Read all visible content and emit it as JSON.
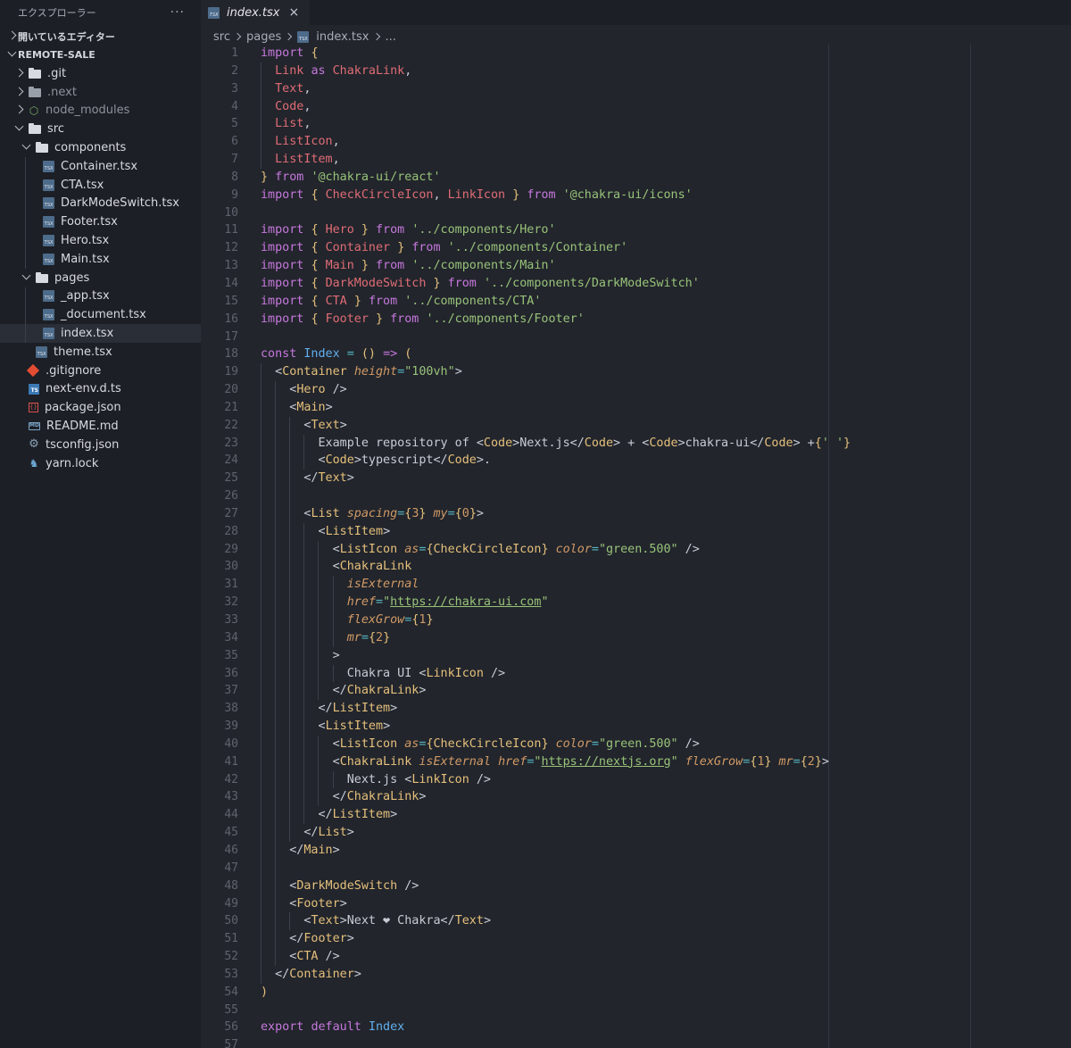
{
  "explorer": {
    "title": "エクスプローラー",
    "more": "···",
    "open_editors": "開いているエディター",
    "project": "REMOTE-SALE",
    "tree": [
      {
        "label": ".git",
        "type": "folder",
        "depth": 1,
        "state": "closed",
        "dim": false
      },
      {
        "label": ".next",
        "type": "folder",
        "depth": 1,
        "state": "closed",
        "dim": true
      },
      {
        "label": "node_modules",
        "type": "node",
        "depth": 1,
        "state": "closed",
        "dim": true
      },
      {
        "label": "src",
        "type": "folder",
        "depth": 1,
        "state": "open",
        "dim": false
      },
      {
        "label": "components",
        "type": "folder",
        "depth": 2,
        "state": "open",
        "dim": false
      },
      {
        "label": "Container.tsx",
        "type": "tsx",
        "depth": 3
      },
      {
        "label": "CTA.tsx",
        "type": "tsx",
        "depth": 3
      },
      {
        "label": "DarkModeSwitch.tsx",
        "type": "tsx",
        "depth": 3
      },
      {
        "label": "Footer.tsx",
        "type": "tsx",
        "depth": 3
      },
      {
        "label": "Hero.tsx",
        "type": "tsx",
        "depth": 3
      },
      {
        "label": "Main.tsx",
        "type": "tsx",
        "depth": 3
      },
      {
        "label": "pages",
        "type": "folder",
        "depth": 2,
        "state": "open",
        "dim": false
      },
      {
        "label": "_app.tsx",
        "type": "tsx",
        "depth": 3
      },
      {
        "label": "_document.tsx",
        "type": "tsx",
        "depth": 3
      },
      {
        "label": "index.tsx",
        "type": "tsx",
        "depth": 3,
        "selected": true
      },
      {
        "label": "theme.tsx",
        "type": "tsx",
        "depth": 2
      },
      {
        "label": ".gitignore",
        "type": "git",
        "depth": 1
      },
      {
        "label": "next-env.d.ts",
        "type": "ts",
        "depth": 1
      },
      {
        "label": "package.json",
        "type": "json",
        "depth": 1
      },
      {
        "label": "README.md",
        "type": "md",
        "depth": 1
      },
      {
        "label": "tsconfig.json",
        "type": "gear",
        "depth": 1
      },
      {
        "label": "yarn.lock",
        "type": "yarn",
        "depth": 1
      }
    ]
  },
  "tab": {
    "label": "index.tsx",
    "close": "×"
  },
  "breadcrumb": {
    "src": "src",
    "pages": "pages",
    "file": "index.tsx",
    "more": "..."
  },
  "icons": {
    "tsx": "TSX",
    "ts": "TS",
    "json": "{}",
    "md": "MD",
    "gear": "⚙",
    "yarn": "♞",
    "node": "⬡"
  },
  "code_lines": [
    [
      [
        "kw",
        "import"
      ],
      [
        "pu",
        " "
      ],
      [
        "br",
        "{"
      ]
    ],
    [
      [
        "pu",
        "  "
      ],
      [
        "id",
        "Link"
      ],
      [
        "pu",
        " "
      ],
      [
        "kw",
        "as"
      ],
      [
        "pu",
        " "
      ],
      [
        "id",
        "ChakraLink"
      ],
      [
        "pu",
        ","
      ]
    ],
    [
      [
        "pu",
        "  "
      ],
      [
        "id",
        "Text"
      ],
      [
        "pu",
        ","
      ]
    ],
    [
      [
        "pu",
        "  "
      ],
      [
        "id",
        "Code"
      ],
      [
        "pu",
        ","
      ]
    ],
    [
      [
        "pu",
        "  "
      ],
      [
        "id",
        "List"
      ],
      [
        "pu",
        ","
      ]
    ],
    [
      [
        "pu",
        "  "
      ],
      [
        "id",
        "ListIcon"
      ],
      [
        "pu",
        ","
      ]
    ],
    [
      [
        "pu",
        "  "
      ],
      [
        "id",
        "ListItem"
      ],
      [
        "pu",
        ","
      ]
    ],
    [
      [
        "br",
        "}"
      ],
      [
        "pu",
        " "
      ],
      [
        "kw",
        "from"
      ],
      [
        "pu",
        " "
      ],
      [
        "str",
        "'@chakra-ui/react'"
      ]
    ],
    [
      [
        "kw",
        "import"
      ],
      [
        "pu",
        " "
      ],
      [
        "br",
        "{"
      ],
      [
        "pu",
        " "
      ],
      [
        "id",
        "CheckCircleIcon"
      ],
      [
        "pu",
        ", "
      ],
      [
        "id",
        "LinkIcon"
      ],
      [
        "pu",
        " "
      ],
      [
        "br",
        "}"
      ],
      [
        "pu",
        " "
      ],
      [
        "kw",
        "from"
      ],
      [
        "pu",
        " "
      ],
      [
        "str",
        "'@chakra-ui/icons'"
      ]
    ],
    [],
    [
      [
        "kw",
        "import"
      ],
      [
        "pu",
        " "
      ],
      [
        "br",
        "{"
      ],
      [
        "pu",
        " "
      ],
      [
        "id",
        "Hero"
      ],
      [
        "pu",
        " "
      ],
      [
        "br",
        "}"
      ],
      [
        "pu",
        " "
      ],
      [
        "kw",
        "from"
      ],
      [
        "pu",
        " "
      ],
      [
        "str",
        "'../components/Hero'"
      ]
    ],
    [
      [
        "kw",
        "import"
      ],
      [
        "pu",
        " "
      ],
      [
        "br",
        "{"
      ],
      [
        "pu",
        " "
      ],
      [
        "id",
        "Container"
      ],
      [
        "pu",
        " "
      ],
      [
        "br",
        "}"
      ],
      [
        "pu",
        " "
      ],
      [
        "kw",
        "from"
      ],
      [
        "pu",
        " "
      ],
      [
        "str",
        "'../components/Container'"
      ]
    ],
    [
      [
        "kw",
        "import"
      ],
      [
        "pu",
        " "
      ],
      [
        "br",
        "{"
      ],
      [
        "pu",
        " "
      ],
      [
        "id",
        "Main"
      ],
      [
        "pu",
        " "
      ],
      [
        "br",
        "}"
      ],
      [
        "pu",
        " "
      ],
      [
        "kw",
        "from"
      ],
      [
        "pu",
        " "
      ],
      [
        "str",
        "'../components/Main'"
      ]
    ],
    [
      [
        "kw",
        "import"
      ],
      [
        "pu",
        " "
      ],
      [
        "br",
        "{"
      ],
      [
        "pu",
        " "
      ],
      [
        "id",
        "DarkModeSwitch"
      ],
      [
        "pu",
        " "
      ],
      [
        "br",
        "}"
      ],
      [
        "pu",
        " "
      ],
      [
        "kw",
        "from"
      ],
      [
        "pu",
        " "
      ],
      [
        "str",
        "'../components/DarkModeSwitch'"
      ]
    ],
    [
      [
        "kw",
        "import"
      ],
      [
        "pu",
        " "
      ],
      [
        "br",
        "{"
      ],
      [
        "pu",
        " "
      ],
      [
        "id",
        "CTA"
      ],
      [
        "pu",
        " "
      ],
      [
        "br",
        "}"
      ],
      [
        "pu",
        " "
      ],
      [
        "kw",
        "from"
      ],
      [
        "pu",
        " "
      ],
      [
        "str",
        "'../components/CTA'"
      ]
    ],
    [
      [
        "kw",
        "import"
      ],
      [
        "pu",
        " "
      ],
      [
        "br",
        "{"
      ],
      [
        "pu",
        " "
      ],
      [
        "id",
        "Footer"
      ],
      [
        "pu",
        " "
      ],
      [
        "br",
        "}"
      ],
      [
        "pu",
        " "
      ],
      [
        "kw",
        "from"
      ],
      [
        "pu",
        " "
      ],
      [
        "str",
        "'../components/Footer'"
      ]
    ],
    [],
    [
      [
        "kw",
        "const"
      ],
      [
        "pu",
        " "
      ],
      [
        "fn",
        "Index"
      ],
      [
        "pu",
        " "
      ],
      [
        "op",
        "="
      ],
      [
        "pu",
        " "
      ],
      [
        "br",
        "()"
      ],
      [
        "pu",
        " "
      ],
      [
        "kw",
        "=>"
      ],
      [
        "pu",
        " "
      ],
      [
        "br",
        "("
      ]
    ],
    [
      [
        "pu",
        "  <"
      ],
      [
        "tag",
        "Container"
      ],
      [
        "pu",
        " "
      ],
      [
        "attr",
        "height"
      ],
      [
        "op",
        "="
      ],
      [
        "str",
        "\"100vh\""
      ],
      [
        "pu",
        ">"
      ]
    ],
    [
      [
        "pu",
        "    <"
      ],
      [
        "tag",
        "Hero"
      ],
      [
        "pu",
        " />"
      ]
    ],
    [
      [
        "pu",
        "    <"
      ],
      [
        "tag",
        "Main"
      ],
      [
        "pu",
        ">"
      ]
    ],
    [
      [
        "pu",
        "      <"
      ],
      [
        "tag",
        "Text"
      ],
      [
        "pu",
        ">"
      ]
    ],
    [
      [
        "txt",
        "        Example repository of <"
      ],
      [
        "tag",
        "Code"
      ],
      [
        "txt",
        ">Next.js</"
      ],
      [
        "tag",
        "Code"
      ],
      [
        "txt",
        "> + <"
      ],
      [
        "tag",
        "Code"
      ],
      [
        "txt",
        ">chakra-ui</"
      ],
      [
        "tag",
        "Code"
      ],
      [
        "txt",
        "> +"
      ],
      [
        "br",
        "{"
      ],
      [
        "str",
        "' '"
      ],
      [
        "br",
        "}"
      ]
    ],
    [
      [
        "txt",
        "        <"
      ],
      [
        "tag",
        "Code"
      ],
      [
        "txt",
        ">typescript</"
      ],
      [
        "tag",
        "Code"
      ],
      [
        "txt",
        ">."
      ]
    ],
    [
      [
        "pu",
        "      </"
      ],
      [
        "tag",
        "Text"
      ],
      [
        "pu",
        ">"
      ]
    ],
    [],
    [
      [
        "pu",
        "      <"
      ],
      [
        "tag",
        "List"
      ],
      [
        "pu",
        " "
      ],
      [
        "attr",
        "spacing"
      ],
      [
        "op",
        "="
      ],
      [
        "br",
        "{"
      ],
      [
        "num",
        "3"
      ],
      [
        "br",
        "}"
      ],
      [
        "pu",
        " "
      ],
      [
        "attr",
        "my"
      ],
      [
        "op",
        "="
      ],
      [
        "br",
        "{"
      ],
      [
        "num",
        "0"
      ],
      [
        "br",
        "}"
      ],
      [
        "pu",
        ">"
      ]
    ],
    [
      [
        "pu",
        "        <"
      ],
      [
        "tag",
        "ListItem"
      ],
      [
        "pu",
        ">"
      ]
    ],
    [
      [
        "pu",
        "          <"
      ],
      [
        "tag",
        "ListIcon"
      ],
      [
        "pu",
        " "
      ],
      [
        "attr",
        "as"
      ],
      [
        "op",
        "="
      ],
      [
        "br",
        "{"
      ],
      [
        "tag",
        "CheckCircleIcon"
      ],
      [
        "br",
        "}"
      ],
      [
        "pu",
        " "
      ],
      [
        "attr",
        "color"
      ],
      [
        "op",
        "="
      ],
      [
        "str",
        "\"green.500\""
      ],
      [
        "pu",
        " />"
      ]
    ],
    [
      [
        "pu",
        "          <"
      ],
      [
        "tag",
        "ChakraLink"
      ]
    ],
    [
      [
        "pu",
        "            "
      ],
      [
        "attr",
        "isExternal"
      ]
    ],
    [
      [
        "pu",
        "            "
      ],
      [
        "attr",
        "href"
      ],
      [
        "op",
        "="
      ],
      [
        "str",
        "\""
      ],
      [
        "url",
        "https://chakra-ui.com"
      ],
      [
        "str",
        "\""
      ]
    ],
    [
      [
        "pu",
        "            "
      ],
      [
        "attr",
        "flexGrow"
      ],
      [
        "op",
        "="
      ],
      [
        "br",
        "{"
      ],
      [
        "num",
        "1"
      ],
      [
        "br",
        "}"
      ]
    ],
    [
      [
        "pu",
        "            "
      ],
      [
        "attr",
        "mr"
      ],
      [
        "op",
        "="
      ],
      [
        "br",
        "{"
      ],
      [
        "num",
        "2"
      ],
      [
        "br",
        "}"
      ]
    ],
    [
      [
        "pu",
        "          >"
      ]
    ],
    [
      [
        "txt",
        "            Chakra UI <"
      ],
      [
        "tag",
        "LinkIcon"
      ],
      [
        "txt",
        " />"
      ]
    ],
    [
      [
        "pu",
        "          </"
      ],
      [
        "tag",
        "ChakraLink"
      ],
      [
        "pu",
        ">"
      ]
    ],
    [
      [
        "pu",
        "        </"
      ],
      [
        "tag",
        "ListItem"
      ],
      [
        "pu",
        ">"
      ]
    ],
    [
      [
        "pu",
        "        <"
      ],
      [
        "tag",
        "ListItem"
      ],
      [
        "pu",
        ">"
      ]
    ],
    [
      [
        "pu",
        "          <"
      ],
      [
        "tag",
        "ListIcon"
      ],
      [
        "pu",
        " "
      ],
      [
        "attr",
        "as"
      ],
      [
        "op",
        "="
      ],
      [
        "br",
        "{"
      ],
      [
        "tag",
        "CheckCircleIcon"
      ],
      [
        "br",
        "}"
      ],
      [
        "pu",
        " "
      ],
      [
        "attr",
        "color"
      ],
      [
        "op",
        "="
      ],
      [
        "str",
        "\"green.500\""
      ],
      [
        "pu",
        " />"
      ]
    ],
    [
      [
        "pu",
        "          <"
      ],
      [
        "tag",
        "ChakraLink"
      ],
      [
        "pu",
        " "
      ],
      [
        "attr",
        "isExternal"
      ],
      [
        "pu",
        " "
      ],
      [
        "attr",
        "href"
      ],
      [
        "op",
        "="
      ],
      [
        "str",
        "\""
      ],
      [
        "url",
        "https://nextjs.org"
      ],
      [
        "str",
        "\""
      ],
      [
        "pu",
        " "
      ],
      [
        "attr",
        "flexGrow"
      ],
      [
        "op",
        "="
      ],
      [
        "br",
        "{"
      ],
      [
        "num",
        "1"
      ],
      [
        "br",
        "}"
      ],
      [
        "pu",
        " "
      ],
      [
        "attr",
        "mr"
      ],
      [
        "op",
        "="
      ],
      [
        "br",
        "{"
      ],
      [
        "num",
        "2"
      ],
      [
        "br",
        "}"
      ],
      [
        "pu",
        ">"
      ]
    ],
    [
      [
        "txt",
        "            Next.js <"
      ],
      [
        "tag",
        "LinkIcon"
      ],
      [
        "txt",
        " />"
      ]
    ],
    [
      [
        "pu",
        "          </"
      ],
      [
        "tag",
        "ChakraLink"
      ],
      [
        "pu",
        ">"
      ]
    ],
    [
      [
        "pu",
        "        </"
      ],
      [
        "tag",
        "ListItem"
      ],
      [
        "pu",
        ">"
      ]
    ],
    [
      [
        "pu",
        "      </"
      ],
      [
        "tag",
        "List"
      ],
      [
        "pu",
        ">"
      ]
    ],
    [
      [
        "pu",
        "    </"
      ],
      [
        "tag",
        "Main"
      ],
      [
        "pu",
        ">"
      ]
    ],
    [],
    [
      [
        "pu",
        "    <"
      ],
      [
        "tag",
        "DarkModeSwitch"
      ],
      [
        "pu",
        " />"
      ]
    ],
    [
      [
        "pu",
        "    <"
      ],
      [
        "tag",
        "Footer"
      ],
      [
        "pu",
        ">"
      ]
    ],
    [
      [
        "pu",
        "      <"
      ],
      [
        "tag",
        "Text"
      ],
      [
        "txt",
        ">Next ❤ Chakra</"
      ],
      [
        "tag",
        "Text"
      ],
      [
        "pu",
        ">"
      ]
    ],
    [
      [
        "pu",
        "    </"
      ],
      [
        "tag",
        "Footer"
      ],
      [
        "pu",
        ">"
      ]
    ],
    [
      [
        "pu",
        "    <"
      ],
      [
        "tag",
        "CTA"
      ],
      [
        "pu",
        " />"
      ]
    ],
    [
      [
        "pu",
        "  </"
      ],
      [
        "tag",
        "Container"
      ],
      [
        "pu",
        ">"
      ]
    ],
    [
      [
        "br",
        ")"
      ]
    ],
    [],
    [
      [
        "kw",
        "export"
      ],
      [
        "pu",
        " "
      ],
      [
        "kw",
        "default"
      ],
      [
        "pu",
        " "
      ],
      [
        "fn",
        "Index"
      ]
    ],
    []
  ],
  "indent_levels": [
    0,
    1,
    1,
    1,
    1,
    1,
    1,
    0,
    0,
    0,
    0,
    0,
    0,
    0,
    0,
    0,
    0,
    0,
    1,
    2,
    2,
    3,
    4,
    4,
    3,
    3,
    3,
    4,
    5,
    5,
    6,
    6,
    6,
    6,
    5,
    6,
    5,
    4,
    4,
    5,
    5,
    6,
    5,
    4,
    3,
    2,
    2,
    2,
    2,
    3,
    2,
    2,
    1,
    0,
    0,
    0,
    0
  ],
  "colors": {
    "bg_editor": "#22252c",
    "bg_sidebar": "#1c1f25",
    "keyword": "#c678dd",
    "identifier": "#e06c75",
    "string": "#98c379",
    "tag": "#e5c07b",
    "attribute": "#d19a66"
  }
}
